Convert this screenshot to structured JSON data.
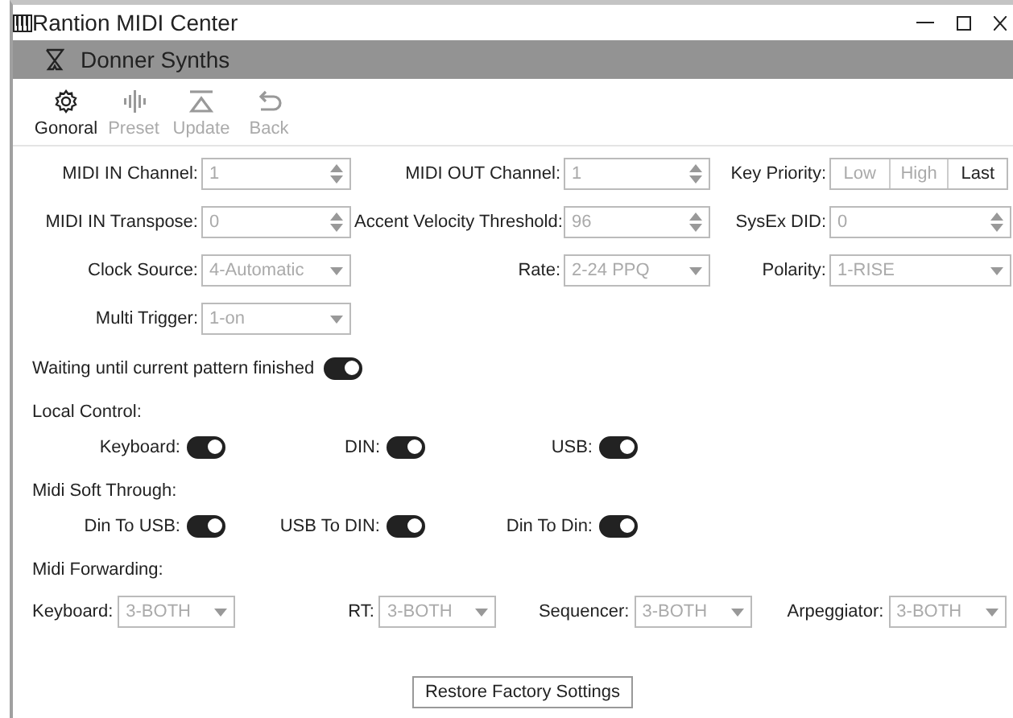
{
  "window": {
    "title": "Rantion MIDI Center"
  },
  "device_bar": {
    "name": "Donner Synths"
  },
  "toolbar": [
    {
      "kind": "gear",
      "label": "Gonoral",
      "disabled": false
    },
    {
      "kind": "wave",
      "label": "Preset",
      "disabled": true
    },
    {
      "kind": "upload",
      "label": "Update",
      "disabled": true
    },
    {
      "kind": "back",
      "label": "Back",
      "disabled": true
    }
  ],
  "fields": [
    {
      "kind": "spin",
      "label": "MIDI IN Channel:",
      "value": "1",
      "disabled": true
    },
    {
      "kind": "spin",
      "label": "MIDI OUT Channel:",
      "value": "1",
      "disabled": true
    },
    {
      "kind": "segmented",
      "label": "Key Priority:",
      "options": [
        {
          "label": "Low",
          "selected": false
        },
        {
          "label": "High",
          "selected": false
        },
        {
          "label": "Last",
          "selected": true
        }
      ]
    },
    {
      "kind": "spin",
      "label": "MIDI IN Transpose:",
      "value": "0",
      "disabled": true
    },
    {
      "kind": "spin",
      "label": "Accent Velocity Threshold:",
      "value": "96",
      "disabled": true
    },
    {
      "kind": "spin",
      "label": "SysEx DID:",
      "value": "0",
      "disabled": true
    },
    {
      "kind": "select",
      "label": "Clock Source:",
      "value": "4-Automatic",
      "disabled": true
    },
    {
      "kind": "select",
      "label": "Rate:",
      "value": "2-24 PPQ",
      "disabled": true
    },
    {
      "kind": "select",
      "label": "Polarity:",
      "value": "1-RISE",
      "disabled": true
    },
    {
      "kind": "select",
      "label": "Multi Trigger:",
      "value": "1-on",
      "disabled": true
    }
  ],
  "waiting": {
    "label": "Waiting until current pattern finished",
    "on": true
  },
  "toggle_groups": [
    {
      "title": "Local Control:",
      "items": [
        {
          "label": "Keyboard:",
          "on": true
        },
        {
          "label": "DIN:",
          "on": true
        },
        {
          "label": "USB:",
          "on": true
        }
      ]
    },
    {
      "title": "Midi Soft Through:",
      "items": [
        {
          "label": "Din To USB:",
          "on": true
        },
        {
          "label": "USB To DIN:",
          "on": true
        },
        {
          "label": "Din To Din:",
          "on": true
        }
      ]
    }
  ],
  "forwarding": {
    "title": "Midi Forwarding:",
    "items": [
      {
        "label": "Keyboard:",
        "value": "3-BOTH",
        "disabled": true
      },
      {
        "label": "RT:",
        "value": "3-BOTH",
        "disabled": true
      },
      {
        "label": "Sequencer:",
        "value": "3-BOTH",
        "disabled": true
      },
      {
        "label": "Arpeggiator:",
        "value": "3-BOTH",
        "disabled": true
      }
    ]
  },
  "restore_button": "Restore Factory Sottings"
}
